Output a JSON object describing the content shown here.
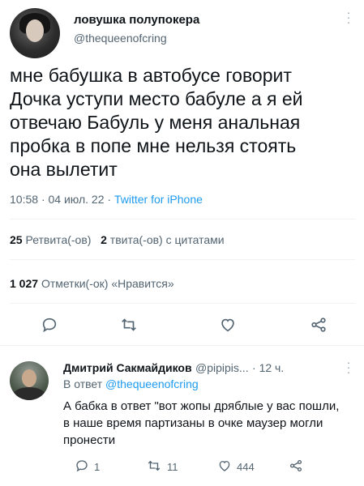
{
  "tweet": {
    "display_name": "ловушка полупокера",
    "handle": "@thequeenofcring",
    "more_icon": "ellipsis-vertical-icon",
    "text": "мне бабушка в автобусе говорит\nДочка уступи место бабуле а я ей\nотвечаю Бабуль у меня анальная\nпробка в попе мне нельзя стоять\nона вылетит",
    "time": "10:58",
    "date": "04 июл. 22",
    "source": "Twitter for iPhone",
    "retweets_count": "25",
    "retweets_label": "Ретвита(-ов)",
    "quotes_count": "2",
    "quotes_label": "твита(-ов) с цитатами",
    "likes_count": "1 027",
    "likes_label": "Отметки(-ок) «Нравится»"
  },
  "actions": {
    "reply_icon": "reply-icon",
    "retweet_icon": "retweet-icon",
    "like_icon": "heart-icon",
    "share_icon": "share-icon"
  },
  "reply": {
    "display_name": "Дмитрий Сакмайдиков",
    "handle": "@pipipis...",
    "time": "· 12 ч.",
    "replying_prefix": "В ответ",
    "replying_to": "@thequeenofcring",
    "text": "А бабка в ответ \"вот жопы дряблые у вас пошли, в наше время партизаны в очке маузер могли пронести",
    "reply_count": "1",
    "retweet_count": "11",
    "like_count": "444"
  },
  "colors": {
    "link": "#1d9bf0",
    "muted": "#536471",
    "text": "#0f1419"
  }
}
